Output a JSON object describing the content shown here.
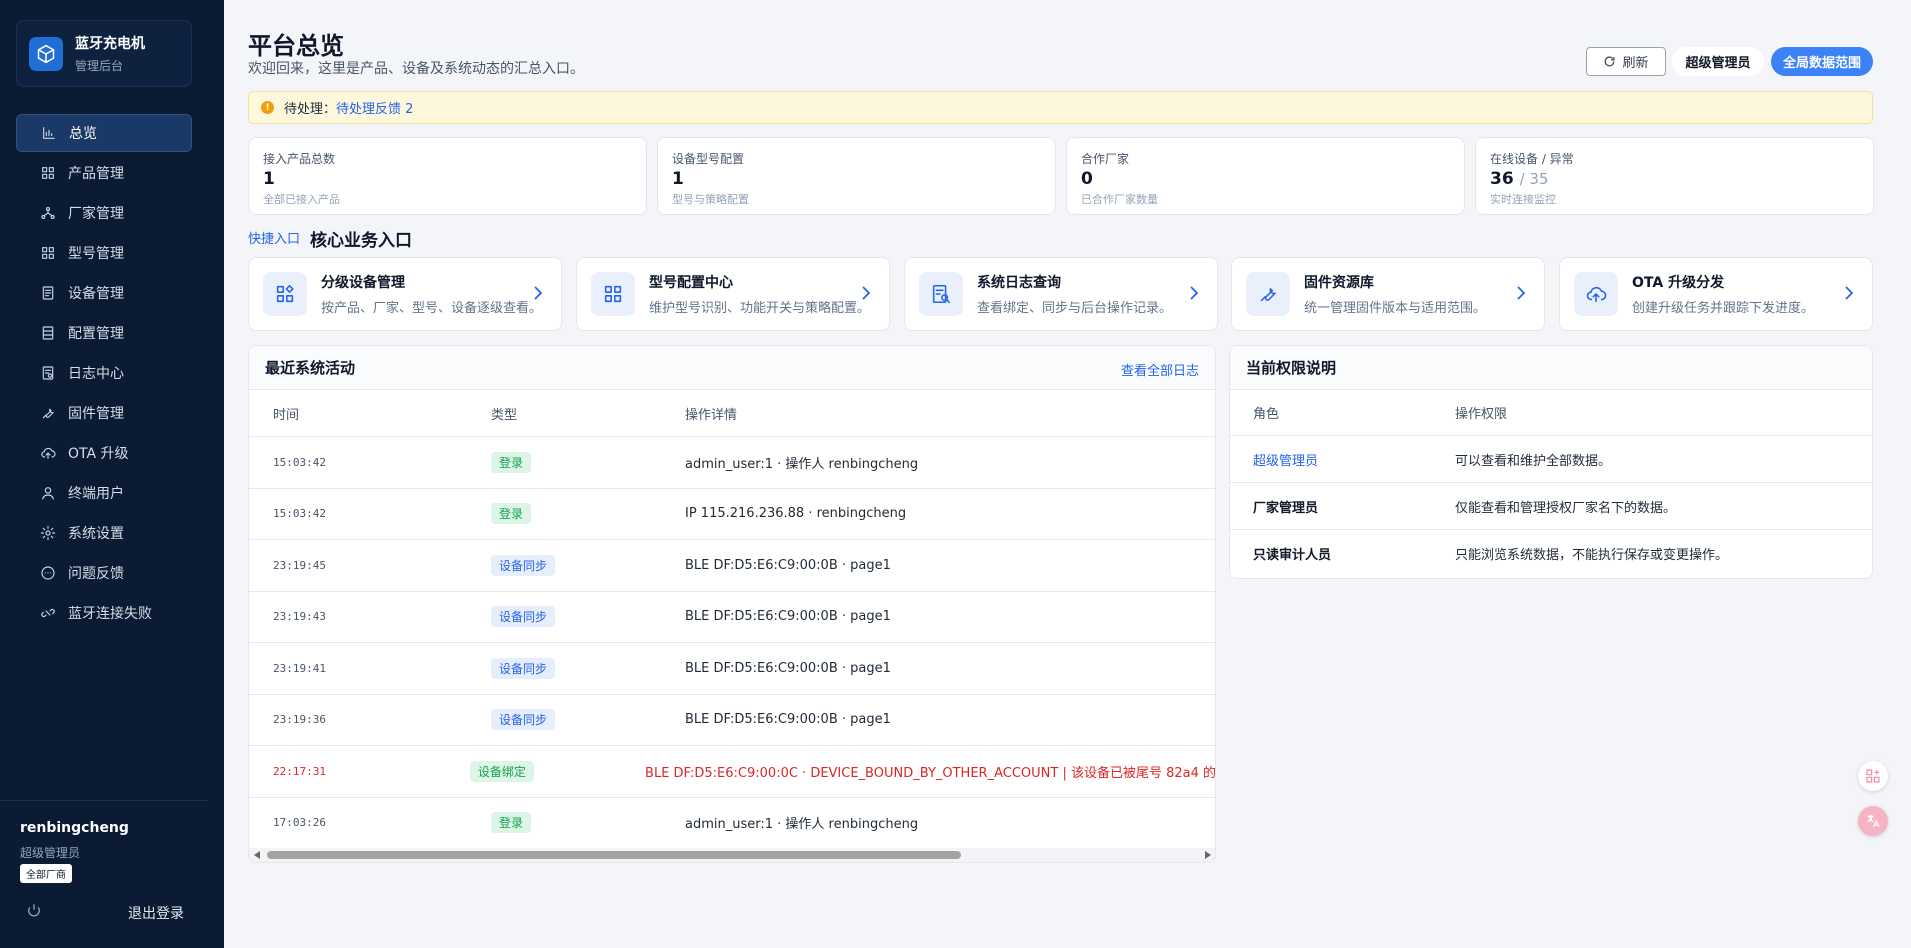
{
  "brand": {
    "title": "蓝牙充电机",
    "subtitle": "管理后台"
  },
  "nav": [
    {
      "label": "总览",
      "icon": "bar-chart-icon",
      "active": true
    },
    {
      "label": "产品管理",
      "icon": "grid-icon"
    },
    {
      "label": "厂家管理",
      "icon": "network-icon"
    },
    {
      "label": "型号管理",
      "icon": "grid-icon"
    },
    {
      "label": "设备管理",
      "icon": "device-icon"
    },
    {
      "label": "配置管理",
      "icon": "config-icon"
    },
    {
      "label": "日志中心",
      "icon": "log-icon"
    },
    {
      "label": "固件管理",
      "icon": "wrench-icon"
    },
    {
      "label": "OTA 升级",
      "icon": "cloud-upload-icon"
    },
    {
      "label": "终端用户",
      "icon": "user-icon"
    },
    {
      "label": "系统设置",
      "icon": "gear-icon"
    },
    {
      "label": "问题反馈",
      "icon": "chat-icon"
    },
    {
      "label": "蓝牙连接失败",
      "icon": "link-broken-icon"
    }
  ],
  "user": {
    "name": "renbingcheng",
    "role": "超级管理员",
    "badge": "全部厂商",
    "logout": "退出登录"
  },
  "header": {
    "title": "平台总览",
    "subtitle": "欢迎回来，这里是产品、设备及系统动态的汇总入口。",
    "refresh": "刷新",
    "role": "超级管理员",
    "scope": "全局数据范围"
  },
  "alert": {
    "label": "待处理：",
    "link": "待处理反馈 2"
  },
  "stats": [
    {
      "label": "接入产品总数",
      "value": "1",
      "extra": "",
      "desc": "全部已接入产品"
    },
    {
      "label": "设备型号配置",
      "value": "1",
      "extra": "",
      "desc": "型号与策略配置"
    },
    {
      "label": "合作厂家",
      "value": "0",
      "extra": "",
      "desc": "已合作厂家数量"
    },
    {
      "label": "在线设备 / 异常",
      "value": "36",
      "extra": "/ 35",
      "desc": "实时连接监控"
    }
  ],
  "quick": {
    "tag": "快捷入口",
    "title": "核心业务入口",
    "cards": [
      {
        "title": "分级设备管理",
        "desc": "按产品、厂家、型号、设备逐级查看。",
        "icon": "devices-grid-icon"
      },
      {
        "title": "型号配置中心",
        "desc": "维护型号识别、功能开关与策略配置。",
        "icon": "grid-icon"
      },
      {
        "title": "系统日志查询",
        "desc": "查看绑定、同步与后台操作记录。",
        "icon": "log-search-icon"
      },
      {
        "title": "固件资源库",
        "desc": "统一管理固件版本与适用范围。",
        "icon": "wrench-icon"
      },
      {
        "title": "OTA 升级分发",
        "desc": "创建升级任务并跟踪下发进度。",
        "icon": "cloud-upload-icon"
      }
    ]
  },
  "activity": {
    "title": "最近系统活动",
    "link": "查看全部日志",
    "columns": [
      "时间",
      "类型",
      "操作详情"
    ],
    "rows": [
      {
        "time": "15:03:42",
        "type": "登录",
        "color": "green",
        "detail": "admin_user:1 · 操作人 renbingcheng",
        "error": false
      },
      {
        "time": "15:03:42",
        "type": "登录",
        "color": "green",
        "detail": "IP 115.216.236.88 · renbingcheng",
        "error": false
      },
      {
        "time": "23:19:45",
        "type": "设备同步",
        "color": "blue",
        "detail": "BLE DF:D5:E6:C9:00:0B · page1",
        "error": false
      },
      {
        "time": "23:19:43",
        "type": "设备同步",
        "color": "blue",
        "detail": "BLE DF:D5:E6:C9:00:0B · page1",
        "error": false
      },
      {
        "time": "23:19:41",
        "type": "设备同步",
        "color": "blue",
        "detail": "BLE DF:D5:E6:C9:00:0B · page1",
        "error": false
      },
      {
        "time": "23:19:36",
        "type": "设备同步",
        "color": "blue",
        "detail": "BLE DF:D5:E6:C9:00:0B · page1",
        "error": false
      },
      {
        "time": "22:17:31",
        "type": "设备绑定",
        "color": "green",
        "detail": "BLE DF:D5:E6:C9:00:0C · DEVICE_BOUND_BY_OTHER_ACCOUNT | 该设备已被尾号 82a4 的",
        "error": true
      },
      {
        "time": "17:03:26",
        "type": "登录",
        "color": "green",
        "detail": "admin_user:1 · 操作人 renbingcheng",
        "error": false
      }
    ]
  },
  "permissions": {
    "title": "当前权限说明",
    "columns": [
      "角色",
      "操作权限"
    ],
    "rows": [
      {
        "role": "超级管理员",
        "desc": "可以查看和维护全部数据。",
        "link": true
      },
      {
        "role": "厂家管理员",
        "desc": "仅能查看和管理授权厂家名下的数据。",
        "link": false
      },
      {
        "role": "只读审计人员",
        "desc": "只能浏览系统数据，不能执行保存或变更操作。",
        "link": false
      }
    ]
  }
}
